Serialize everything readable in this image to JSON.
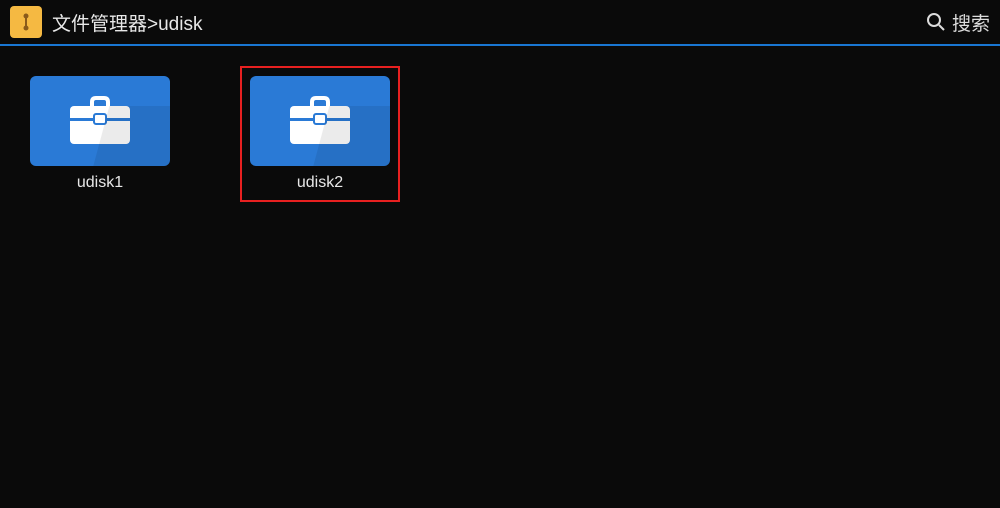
{
  "header": {
    "breadcrumb": "文件管理器>udisk",
    "search_label": "搜索"
  },
  "folders": [
    {
      "label": "udisk1",
      "selected": false
    },
    {
      "label": "udisk2",
      "selected": true
    }
  ]
}
